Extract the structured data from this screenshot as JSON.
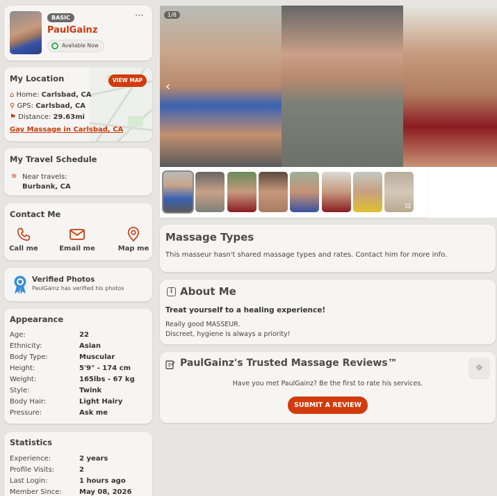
{
  "profile": {
    "badge": "BASIC",
    "name": "PaulGainz",
    "status": "Available Now",
    "more": "⋯"
  },
  "location": {
    "title": "My Location",
    "view_map": "VIEW MAP",
    "home_label": "Home:",
    "home_value": "Carlsbad, CA",
    "gps_label": "GPS:",
    "gps_value": "Carlsbad, CA",
    "distance_label": "Distance:",
    "distance_value": "29.63mi",
    "link": "Gay Massage in Carlsbad, CA"
  },
  "travel": {
    "title": "My Travel Schedule",
    "near_label": "Near travels:",
    "near_value": "Burbank, CA"
  },
  "contact": {
    "title": "Contact Me",
    "call": "Call me",
    "email": "Email me",
    "map": "Map me"
  },
  "verified": {
    "title": "Verified Photos",
    "subtitle": "PaulGainz has verified his photos"
  },
  "appearance": {
    "title": "Appearance",
    "rows": [
      {
        "k": "Age:",
        "v": "22"
      },
      {
        "k": "Ethnicity:",
        "v": "Asian"
      },
      {
        "k": "Body Type:",
        "v": "Muscular"
      },
      {
        "k": "Height:",
        "v": "5'9\" - 174 cm"
      },
      {
        "k": "Weight:",
        "v": "165lbs - 67 kg"
      },
      {
        "k": "Style:",
        "v": "Twink"
      },
      {
        "k": "Body Hair:",
        "v": "Light Hairy"
      },
      {
        "k": "Pressure:",
        "v": "Ask me"
      }
    ]
  },
  "statistics": {
    "title": "Statistics",
    "rows": [
      {
        "k": "Experience:",
        "v": "2 years"
      },
      {
        "k": "Profile Visits:",
        "v": "2"
      },
      {
        "k": "Last Login:",
        "v": "1 hours ago"
      },
      {
        "k": "Member Since:",
        "v": "May 08, 2026"
      }
    ]
  },
  "gallery": {
    "counter": "1/8"
  },
  "massage_types": {
    "title": "Massage Types",
    "text": "This masseur hasn't shared massage types and rates. Contact him for more info."
  },
  "about": {
    "title": "About Me",
    "headline": "Treat yourself to a healing experience!",
    "line1": "Really good MASSEUR.",
    "line2": "Discreet, hygiene is always a priority!"
  },
  "reviews": {
    "title": "PaulGainz's Trusted Massage Reviews™",
    "prompt": "Have you met PaulGainz? Be the first to rate his services.",
    "button": "SUBMIT A REVIEW"
  },
  "colors": {
    "accent": "#d23b0c",
    "online": "#2eaa4a"
  }
}
